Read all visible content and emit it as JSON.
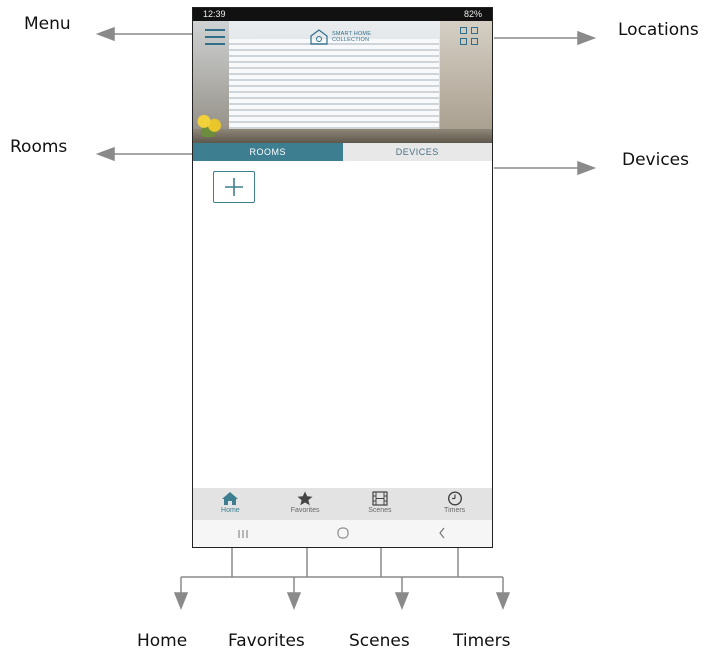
{
  "callouts": {
    "menu": "Menu",
    "locations": "Locations",
    "rooms": "Rooms",
    "devices": "Devices",
    "home": "Home",
    "favorites": "Favorites",
    "scenes": "Scenes",
    "timers": "Timers"
  },
  "status_bar": {
    "time": "12:39",
    "battery": "82%"
  },
  "header": {
    "logo_line1": "SMART HOME",
    "logo_line2": "COLLECTION",
    "accent_color": "#3d7e90",
    "icons": {
      "menu": "hamburger-icon",
      "locations": "grid-icon"
    }
  },
  "tabs": [
    {
      "label": "ROOMS",
      "active": true
    },
    {
      "label": "DEVICES",
      "active": false
    }
  ],
  "bottom_nav": [
    {
      "label": "Home",
      "icon": "home-icon",
      "active": true
    },
    {
      "label": "Favorites",
      "icon": "star-icon",
      "active": false
    },
    {
      "label": "Scenes",
      "icon": "film-icon",
      "active": false
    },
    {
      "label": "Timers",
      "icon": "clock-icon",
      "active": false
    }
  ],
  "system_nav": {
    "recents": "III",
    "home": "○",
    "back": "<"
  }
}
